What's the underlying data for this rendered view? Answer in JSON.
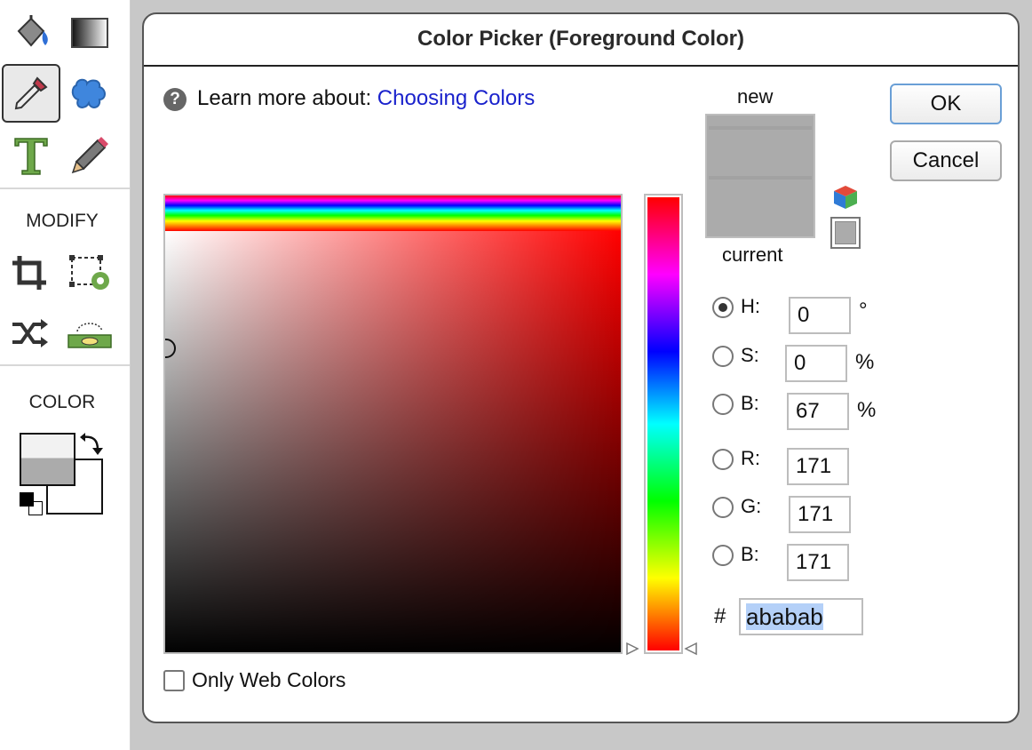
{
  "tool_panel": {
    "sections": {
      "modify": "MODIFY",
      "color": "COLOR"
    },
    "tools": [
      {
        "name": "paint-bucket",
        "icon": "paint-bucket-icon"
      },
      {
        "name": "gradient",
        "icon": "gradient-icon"
      },
      {
        "name": "eyedropper",
        "icon": "eyedropper-icon",
        "selected": true
      },
      {
        "name": "shape",
        "icon": "puzzle-icon"
      },
      {
        "name": "text",
        "icon": "text-tool-icon"
      },
      {
        "name": "pencil",
        "icon": "pencil-icon"
      },
      {
        "name": "crop",
        "icon": "crop-icon"
      },
      {
        "name": "transform-settings",
        "icon": "transform-gear-icon"
      },
      {
        "name": "shuffle",
        "icon": "shuffle-icon"
      },
      {
        "name": "level",
        "icon": "level-icon"
      }
    ],
    "foreground_color": "#ababab",
    "background_color": "#ffffff"
  },
  "dialog": {
    "title": "Color Picker (Foreground Color)",
    "help_prefix": "Learn more about: ",
    "help_link": "Choosing Colors",
    "only_web_colors_label": "Only Web Colors",
    "only_web_colors_checked": false,
    "new_label": "new",
    "current_label": "current",
    "new_color": "#ababab",
    "current_color": "#ababab",
    "ok_label": "OK",
    "cancel_label": "Cancel",
    "fields": {
      "h": {
        "label": "H:",
        "value": "0",
        "unit": "°",
        "selected": true
      },
      "s": {
        "label": "S:",
        "value": "0",
        "unit": "%"
      },
      "b": {
        "label": "B:",
        "value": "67",
        "unit": "%"
      },
      "r": {
        "label": "R:",
        "value": "171"
      },
      "g": {
        "label": "G:",
        "value": "171"
      },
      "b2": {
        "label": "B:",
        "value": "171"
      }
    },
    "hex_prefix": "#",
    "hex_value": "ababab",
    "hue_degrees": 0
  }
}
